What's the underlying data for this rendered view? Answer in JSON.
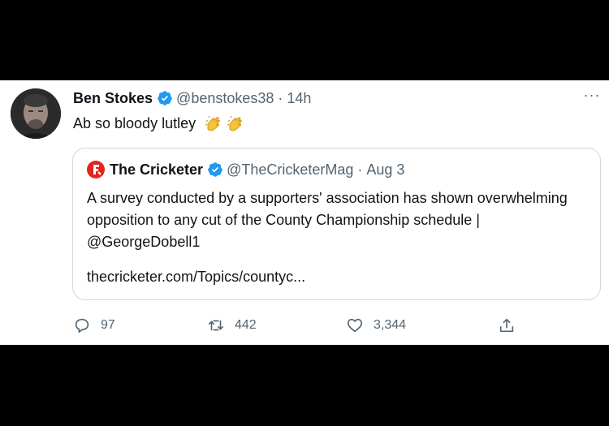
{
  "tweet": {
    "author_name": "Ben Stokes",
    "author_handle": "@benstokes38",
    "separator": "·",
    "time": "14h",
    "more_label": "···",
    "text": "Ab so bloody lutley",
    "emoji": [
      "clapping-hands",
      "clapping-hands"
    ]
  },
  "quote": {
    "author_name": "The Cricketer",
    "author_handle": "@TheCricketerMag",
    "separator": "·",
    "time": "Aug 3",
    "text": "A survey conducted by a supporters' association has shown overwhelming opposition to any cut of the County Championship schedule | @GeorgeDobell1",
    "link": "thecricketer.com/Topics/countyc..."
  },
  "actions": {
    "replies": "97",
    "retweets": "442",
    "likes": "3,344"
  },
  "colors": {
    "verified": "#1d9bf0",
    "secondary_text": "#536471",
    "border": "#cfd9de",
    "cricketer_red": "#e1261c"
  }
}
